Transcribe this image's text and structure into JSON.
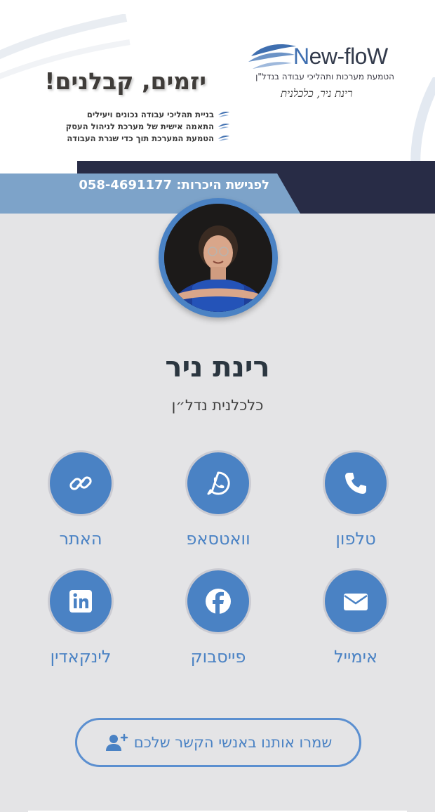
{
  "header": {
    "logo": {
      "brand_n": "N",
      "brand_rest": "ew-floW",
      "subtitle": "הטמעת מערכות ותהליכי עבודה בנדל\"ן",
      "signature": "רינת ניר, כלכלנית"
    },
    "headline": "יזמים, קבלנים!",
    "bullets": [
      "בניית תהליכי עבודה נכונים ויעילים",
      "התאמה אישית של מערכת לניהול העסק",
      "הטמעת המערכת תוך כדי שגרת העבודה"
    ],
    "meeting": "לפגישת היכרות: 058-4691177"
  },
  "profile": {
    "name": "רינת ניר",
    "title": "כלכלנית נדל״ן"
  },
  "actions": [
    {
      "label": "טלפון",
      "icon": "phone-icon"
    },
    {
      "label": "וואטסאפ",
      "icon": "whatsapp-icon"
    },
    {
      "label": "האתר",
      "icon": "link-icon"
    },
    {
      "label": "אימייל",
      "icon": "email-icon"
    },
    {
      "label": "פייסבוק",
      "icon": "facebook-icon"
    },
    {
      "label": "לינקאדין",
      "icon": "linkedin-icon"
    }
  ],
  "save_contact": {
    "label": "שמרו אותנו באנשי הקשר שלכם",
    "icon": "add-user-icon"
  },
  "colors": {
    "accent": "#4a82c4",
    "dark_band": "#282c46",
    "meeting_band": "#7da3c9",
    "background": "#e4e4e6"
  }
}
